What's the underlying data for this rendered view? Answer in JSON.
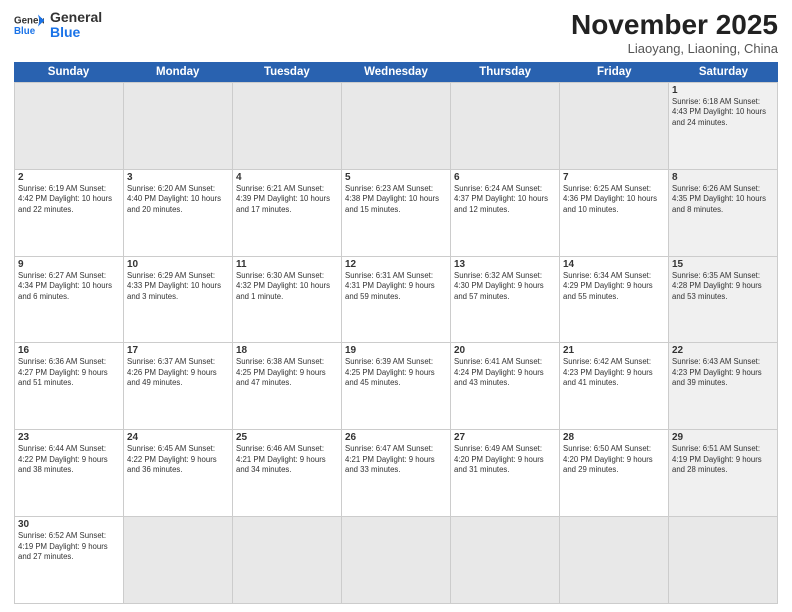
{
  "logo": {
    "general": "General",
    "blue": "Blue"
  },
  "title": "November 2025",
  "location": "Liaoyang, Liaoning, China",
  "dayHeaders": [
    "Sunday",
    "Monday",
    "Tuesday",
    "Wednesday",
    "Thursday",
    "Friday",
    "Saturday"
  ],
  "weeks": [
    [
      {
        "day": "",
        "data": "",
        "empty": true
      },
      {
        "day": "",
        "data": "",
        "empty": true
      },
      {
        "day": "",
        "data": "",
        "empty": true
      },
      {
        "day": "",
        "data": "",
        "empty": true
      },
      {
        "day": "",
        "data": "",
        "empty": true
      },
      {
        "day": "",
        "data": "",
        "empty": true
      },
      {
        "day": "1",
        "data": "Sunrise: 6:18 AM\nSunset: 4:43 PM\nDaylight: 10 hours and 24 minutes.",
        "shaded": true
      }
    ],
    [
      {
        "day": "2",
        "data": "Sunrise: 6:19 AM\nSunset: 4:42 PM\nDaylight: 10 hours and 22 minutes."
      },
      {
        "day": "3",
        "data": "Sunrise: 6:20 AM\nSunset: 4:40 PM\nDaylight: 10 hours and 20 minutes."
      },
      {
        "day": "4",
        "data": "Sunrise: 6:21 AM\nSunset: 4:39 PM\nDaylight: 10 hours and 17 minutes."
      },
      {
        "day": "5",
        "data": "Sunrise: 6:23 AM\nSunset: 4:38 PM\nDaylight: 10 hours and 15 minutes."
      },
      {
        "day": "6",
        "data": "Sunrise: 6:24 AM\nSunset: 4:37 PM\nDaylight: 10 hours and 12 minutes."
      },
      {
        "day": "7",
        "data": "Sunrise: 6:25 AM\nSunset: 4:36 PM\nDaylight: 10 hours and 10 minutes."
      },
      {
        "day": "8",
        "data": "Sunrise: 6:26 AM\nSunset: 4:35 PM\nDaylight: 10 hours and 8 minutes.",
        "shaded": true
      }
    ],
    [
      {
        "day": "9",
        "data": "Sunrise: 6:27 AM\nSunset: 4:34 PM\nDaylight: 10 hours and 6 minutes."
      },
      {
        "day": "10",
        "data": "Sunrise: 6:29 AM\nSunset: 4:33 PM\nDaylight: 10 hours and 3 minutes."
      },
      {
        "day": "11",
        "data": "Sunrise: 6:30 AM\nSunset: 4:32 PM\nDaylight: 10 hours and 1 minute."
      },
      {
        "day": "12",
        "data": "Sunrise: 6:31 AM\nSunset: 4:31 PM\nDaylight: 9 hours and 59 minutes."
      },
      {
        "day": "13",
        "data": "Sunrise: 6:32 AM\nSunset: 4:30 PM\nDaylight: 9 hours and 57 minutes."
      },
      {
        "day": "14",
        "data": "Sunrise: 6:34 AM\nSunset: 4:29 PM\nDaylight: 9 hours and 55 minutes."
      },
      {
        "day": "15",
        "data": "Sunrise: 6:35 AM\nSunset: 4:28 PM\nDaylight: 9 hours and 53 minutes.",
        "shaded": true
      }
    ],
    [
      {
        "day": "16",
        "data": "Sunrise: 6:36 AM\nSunset: 4:27 PM\nDaylight: 9 hours and 51 minutes."
      },
      {
        "day": "17",
        "data": "Sunrise: 6:37 AM\nSunset: 4:26 PM\nDaylight: 9 hours and 49 minutes."
      },
      {
        "day": "18",
        "data": "Sunrise: 6:38 AM\nSunset: 4:25 PM\nDaylight: 9 hours and 47 minutes."
      },
      {
        "day": "19",
        "data": "Sunrise: 6:39 AM\nSunset: 4:25 PM\nDaylight: 9 hours and 45 minutes."
      },
      {
        "day": "20",
        "data": "Sunrise: 6:41 AM\nSunset: 4:24 PM\nDaylight: 9 hours and 43 minutes."
      },
      {
        "day": "21",
        "data": "Sunrise: 6:42 AM\nSunset: 4:23 PM\nDaylight: 9 hours and 41 minutes."
      },
      {
        "day": "22",
        "data": "Sunrise: 6:43 AM\nSunset: 4:23 PM\nDaylight: 9 hours and 39 minutes.",
        "shaded": true
      }
    ],
    [
      {
        "day": "23",
        "data": "Sunrise: 6:44 AM\nSunset: 4:22 PM\nDaylight: 9 hours and 38 minutes."
      },
      {
        "day": "24",
        "data": "Sunrise: 6:45 AM\nSunset: 4:22 PM\nDaylight: 9 hours and 36 minutes."
      },
      {
        "day": "25",
        "data": "Sunrise: 6:46 AM\nSunset: 4:21 PM\nDaylight: 9 hours and 34 minutes."
      },
      {
        "day": "26",
        "data": "Sunrise: 6:47 AM\nSunset: 4:21 PM\nDaylight: 9 hours and 33 minutes."
      },
      {
        "day": "27",
        "data": "Sunrise: 6:49 AM\nSunset: 4:20 PM\nDaylight: 9 hours and 31 minutes."
      },
      {
        "day": "28",
        "data": "Sunrise: 6:50 AM\nSunset: 4:20 PM\nDaylight: 9 hours and 29 minutes."
      },
      {
        "day": "29",
        "data": "Sunrise: 6:51 AM\nSunset: 4:19 PM\nDaylight: 9 hours and 28 minutes.",
        "shaded": true
      }
    ],
    [
      {
        "day": "30",
        "data": "Sunrise: 6:52 AM\nSunset: 4:19 PM\nDaylight: 9 hours and 27 minutes."
      },
      {
        "day": "",
        "data": "",
        "empty": true
      },
      {
        "day": "",
        "data": "",
        "empty": true
      },
      {
        "day": "",
        "data": "",
        "empty": true
      },
      {
        "day": "",
        "data": "",
        "empty": true
      },
      {
        "day": "",
        "data": "",
        "empty": true
      },
      {
        "day": "",
        "data": "",
        "empty": true,
        "shaded": true
      }
    ]
  ]
}
